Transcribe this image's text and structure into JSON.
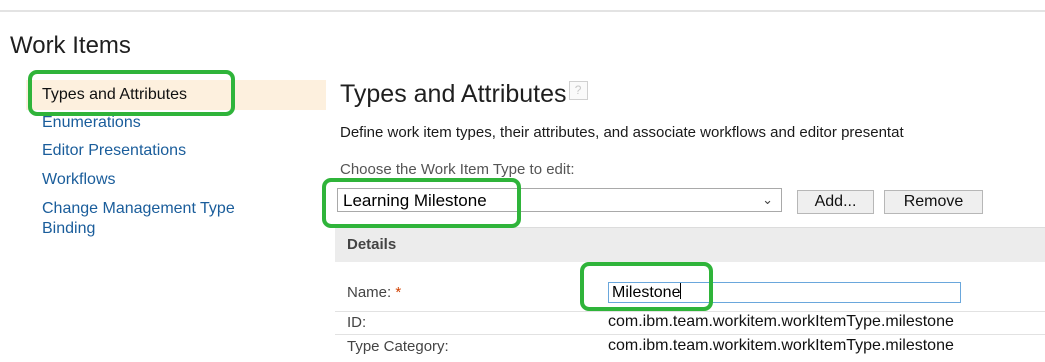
{
  "page": {
    "section_title": "Work Items"
  },
  "sidebar": {
    "items": [
      {
        "label": "Types and Attributes",
        "selected": true
      },
      {
        "label": "Enumerations"
      },
      {
        "label": "Editor Presentations"
      },
      {
        "label": "Workflows"
      },
      {
        "label": "Change Management Type Binding"
      }
    ]
  },
  "content": {
    "title": "Types and Attributes",
    "help_icon": "?",
    "description": "Define work item types, their attributes, and associate workflows and editor presentat",
    "choose_label": "Choose the Work Item Type to edit:",
    "type_select": {
      "value": "Learning Milestone"
    },
    "buttons": {
      "add": "Add...",
      "remove": "Remove"
    },
    "details": {
      "header": "Details",
      "name_label": "Name:",
      "required_mark": "*",
      "name_value": "Milestone",
      "id_label": "ID:",
      "id_value": "com.ibm.team.workitem.workItemType.milestone",
      "category_label": "Type Category:",
      "category_value": "com.ibm.team.workitem.workItemType.milestone"
    }
  },
  "highlight_color": "#2fb43a"
}
